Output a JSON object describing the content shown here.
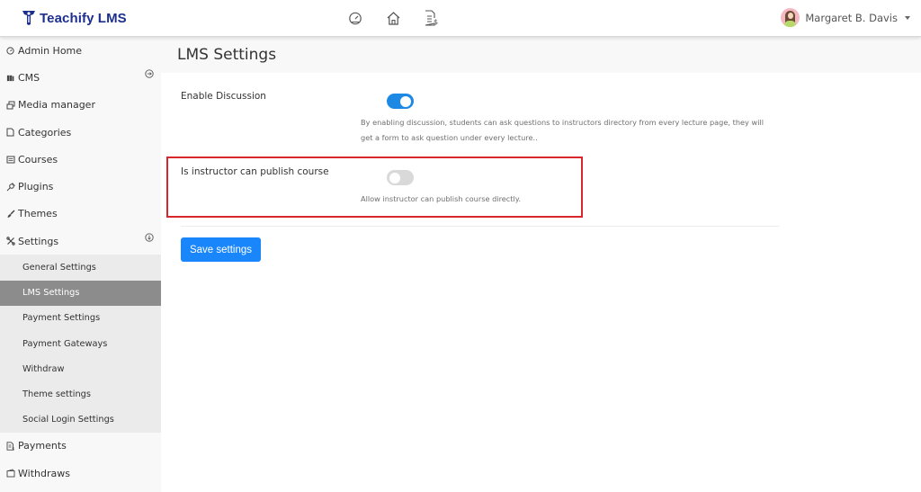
{
  "app": {
    "brand": "Teachify LMS",
    "brand_color": "#1c2f8c",
    "accent_color": "#1a86fc"
  },
  "topbar": {
    "icons": [
      "dashboard-gauge-icon",
      "home-icon",
      "invoice-dollar-icon"
    ],
    "user": {
      "name": "Margaret B. Davis"
    }
  },
  "sidebar": {
    "items": [
      {
        "label": "Admin Home",
        "icon": "gauge-icon"
      },
      {
        "label": "CMS",
        "icon": "book-icon",
        "expander": "collapse"
      },
      {
        "label": "Media manager",
        "icon": "images-icon"
      },
      {
        "label": "Categories",
        "icon": "folder-icon"
      },
      {
        "label": "Courses",
        "icon": "course-icon"
      },
      {
        "label": "Plugins",
        "icon": "plug-icon"
      },
      {
        "label": "Themes",
        "icon": "brush-icon"
      },
      {
        "label": "Settings",
        "icon": "tools-icon",
        "expander": "expand"
      }
    ],
    "settings_submenu": [
      {
        "label": "General Settings",
        "active": false
      },
      {
        "label": "LMS Settings",
        "active": true
      },
      {
        "label": "Payment Settings",
        "active": false
      },
      {
        "label": "Payment Gateways",
        "active": false
      },
      {
        "label": "Withdraw",
        "active": false
      },
      {
        "label": "Theme settings",
        "active": false
      },
      {
        "label": "Social Login Settings",
        "active": false
      }
    ],
    "bottom_items": [
      {
        "label": "Payments",
        "icon": "invoice-icon"
      },
      {
        "label": "Withdraws",
        "icon": "wallet-icon"
      }
    ]
  },
  "main": {
    "title": "LMS Settings",
    "settings": [
      {
        "label": "Enable Discussion",
        "enabled": true,
        "help_line1": "By enabling discussion, students can ask questions to instructors directory from every lecture page, they will",
        "help_line2": "get a form to ask question under every lecture.."
      },
      {
        "label": "Is instructor can publish course",
        "enabled": false,
        "help_line1": "Allow instructor can publish course directly.",
        "highlighted": true,
        "highlight_color": "#d7262c"
      }
    ],
    "save_label": "Save settings"
  }
}
